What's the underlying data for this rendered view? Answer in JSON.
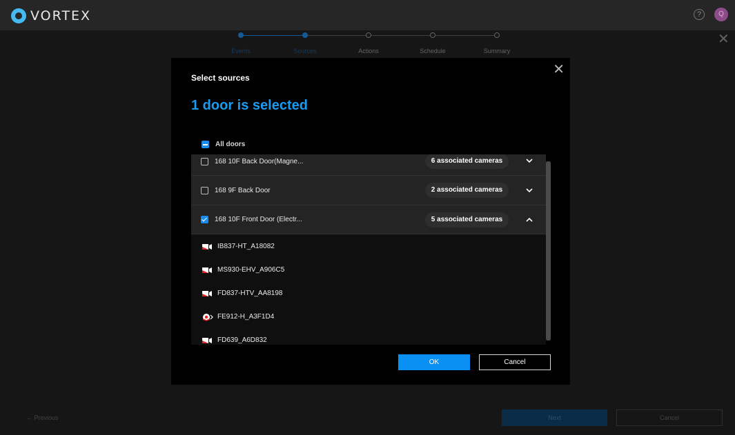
{
  "app": {
    "logo_text": "VORTEX",
    "avatar_initial": "Q"
  },
  "stepper": {
    "steps": [
      {
        "label": "Events",
        "state": "done"
      },
      {
        "label": "Sources",
        "state": "current"
      },
      {
        "label": "Actions",
        "state": "todo"
      },
      {
        "label": "Schedule",
        "state": "todo"
      },
      {
        "label": "Summary",
        "state": "todo"
      }
    ]
  },
  "dialog": {
    "title": "Select sources",
    "selected_text": "1 door is selected",
    "all_doors_label": "All doors",
    "doors": [
      {
        "name": "168 10F Back Door(Magne...",
        "cameras": "6 associated cameras",
        "checked": false,
        "expanded": false
      },
      {
        "name": "168 9F Back Door",
        "cameras": "2 associated cameras",
        "checked": false,
        "expanded": false
      },
      {
        "name": "168 10F Front Door (Electr...",
        "cameras": "5 associated cameras",
        "checked": true,
        "expanded": true
      }
    ],
    "cameras": [
      {
        "name": "IB837-HT_A18082",
        "icon": "bullet-camera-icon"
      },
      {
        "name": "MS930-EHV_A906C5",
        "icon": "bullet-camera-icon"
      },
      {
        "name": "FD837-HTV_AA8198",
        "icon": "bullet-camera-icon"
      },
      {
        "name": "FE912-H_A3F1D4",
        "icon": "fisheye-camera-icon"
      },
      {
        "name": "FD639_A6D832",
        "icon": "bullet-camera-icon"
      }
    ],
    "ok_label": "OK",
    "cancel_label": "Cancel"
  },
  "footer": {
    "previous_label": "← Previous",
    "next_label": "Next",
    "cancel_label": "Cancel"
  },
  "colors": {
    "accent": "#1a9bf0",
    "button_primary": "#0a8ff2",
    "camera_icon": "#e8232a"
  }
}
